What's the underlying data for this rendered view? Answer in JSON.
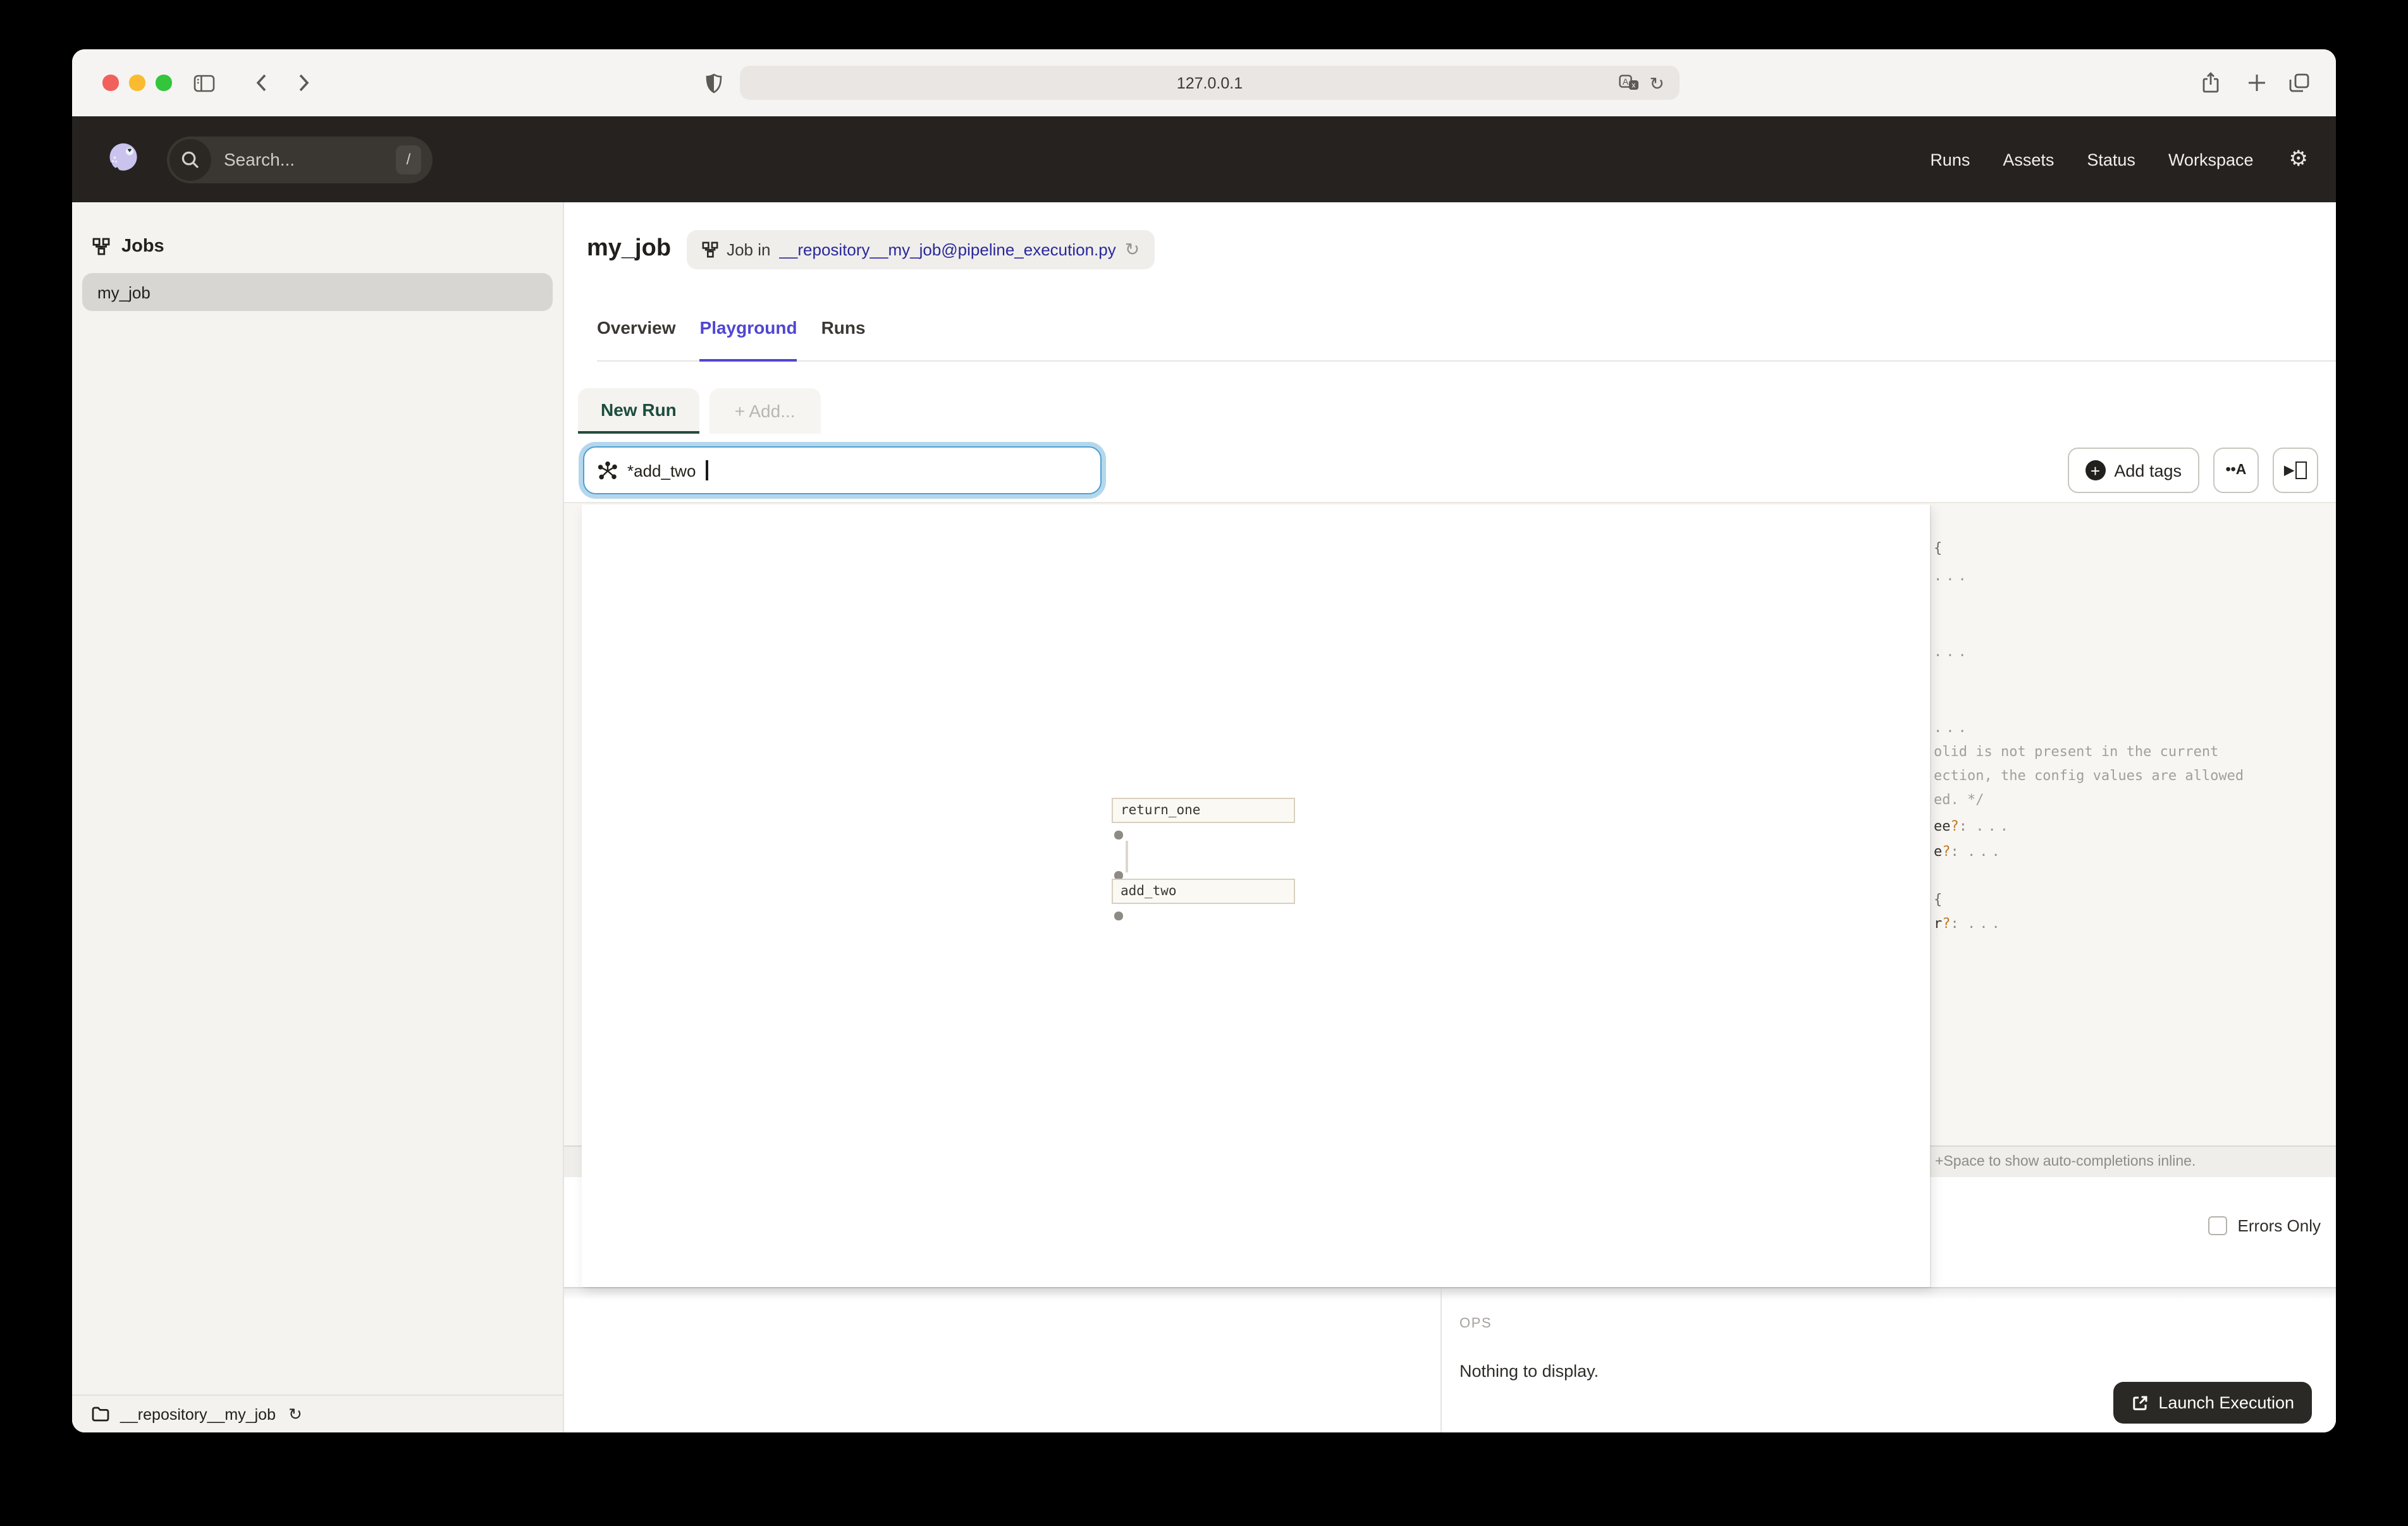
{
  "browser": {
    "url": "127.0.0.1"
  },
  "app_header": {
    "search_placeholder": "Search...",
    "search_shortcut": "/",
    "nav": [
      {
        "label": "Runs"
      },
      {
        "label": "Assets"
      },
      {
        "label": "Status"
      },
      {
        "label": "Workspace"
      }
    ]
  },
  "sidebar": {
    "title": "Jobs",
    "jobs": [
      {
        "label": "my_job",
        "selected": true
      }
    ],
    "repository": "__repository__my_job"
  },
  "page": {
    "title": "my_job",
    "breadcrumb_prefix": "Job in",
    "breadcrumb_link": "__repository__my_job@pipeline_execution.py",
    "tabs": [
      {
        "label": "Overview",
        "active": false
      },
      {
        "label": "Playground",
        "active": true
      },
      {
        "label": "Runs",
        "active": false
      }
    ]
  },
  "playground": {
    "run_tab": "New Run",
    "add_tab": "+ Add...",
    "op_selector_value": "*add_two",
    "add_tags_label": "Add tags",
    "autocomplete_glyph": "••A",
    "graph_nodes": [
      {
        "name": "return_one"
      },
      {
        "name": "add_two"
      }
    ],
    "editor_fragments": [
      {
        "parts": [
          {
            "text": "{",
            "style": "brace"
          }
        ]
      },
      {
        "parts": [
          {
            "text": "...",
            "style": "fold"
          }
        ]
      },
      {
        "parts": [
          {
            "text": "...",
            "style": "fold"
          }
        ]
      },
      {
        "parts": [
          {
            "text": "...",
            "style": "fold"
          }
        ]
      },
      {
        "parts": [
          {
            "text": "olid is not present in the current",
            "style": "comment"
          }
        ]
      },
      {
        "parts": [
          {
            "text": "ection, the config values are allowed",
            "style": "comment"
          }
        ]
      },
      {
        "parts": [
          {
            "text": "ed. */",
            "style": "comment"
          }
        ]
      },
      {
        "parts": [
          {
            "text": "ee",
            "style": "key"
          },
          {
            "text": "?",
            "style": "opt"
          },
          {
            "text": ": ",
            "style": "punc"
          },
          {
            "text": "...",
            "style": "fold"
          }
        ]
      },
      {
        "parts": [
          {
            "text": "e",
            "style": "key"
          },
          {
            "text": "?",
            "style": "opt"
          },
          {
            "text": ": ",
            "style": "punc"
          },
          {
            "text": "...",
            "style": "fold"
          }
        ]
      },
      {
        "parts": [
          {
            "text": "{",
            "style": "brace"
          }
        ]
      },
      {
        "parts": [
          {
            "text": "r",
            "style": "key"
          },
          {
            "text": "?",
            "style": "opt"
          },
          {
            "text": ": ",
            "style": "punc"
          },
          {
            "text": "...",
            "style": "fold"
          }
        ]
      }
    ],
    "hint": "+Space to show auto-completions inline.",
    "errors_only_label": "Errors Only",
    "ops_title": "OPS",
    "ops_empty": "Nothing to display.",
    "launch_label": "Launch Execution"
  },
  "icons": {
    "gear": "⚙",
    "reload": "↻",
    "play": "▶",
    "plus_badge": "+"
  },
  "colors": {
    "accent_tab": "#4f46d2",
    "run_tab_green": "#1d4c3d",
    "focus_blue": "#4da0d6",
    "link_navy": "#28289b",
    "launch_button_bg": "#2b2926",
    "optional_marker": "#bf7a26",
    "header_bg": "#26221f"
  }
}
